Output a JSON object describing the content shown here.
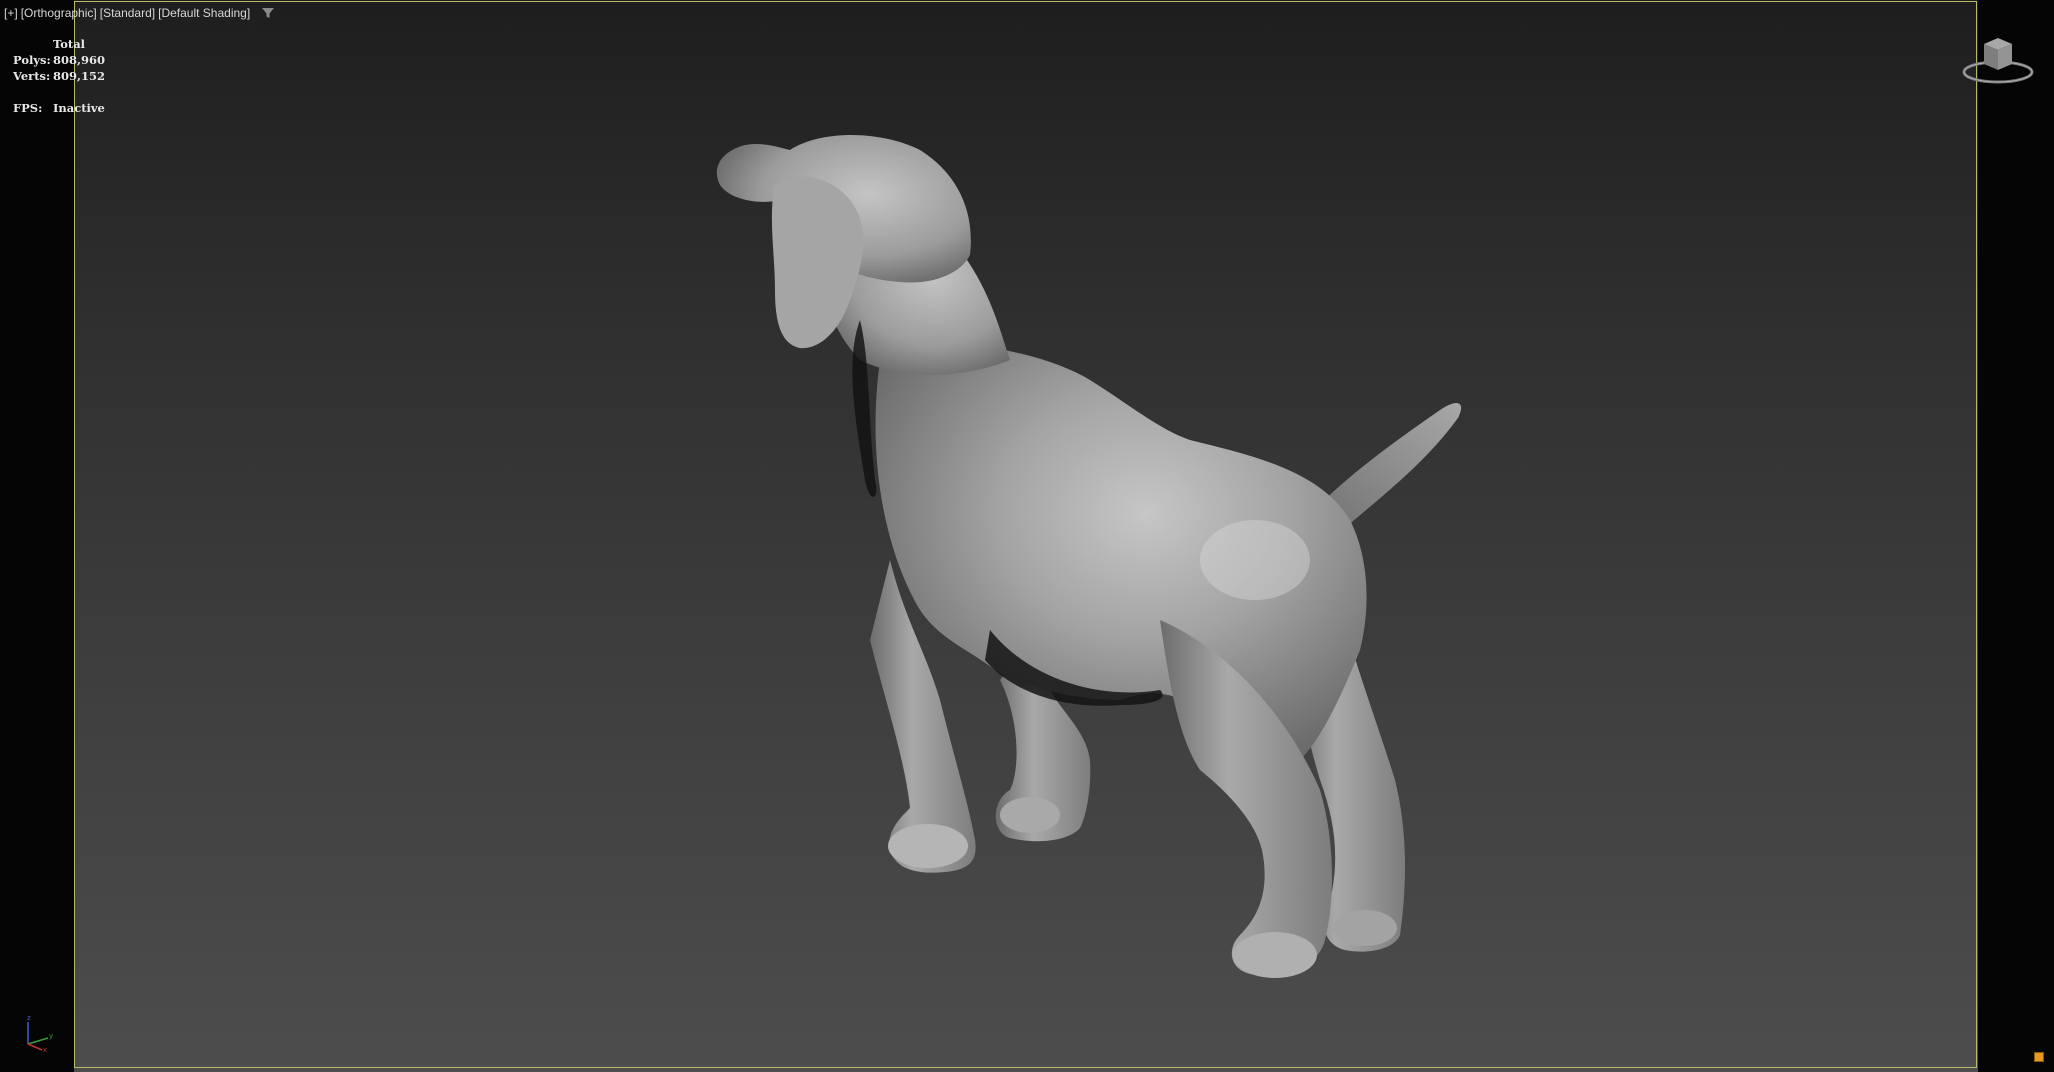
{
  "viewport": {
    "menu_plus": "[+]",
    "menu_view": "[Orthographic]",
    "menu_standard": "[Standard]",
    "menu_shading": "[Default Shading]",
    "filter_icon": "filter-icon"
  },
  "stats": {
    "header": "Total",
    "polys_label": "Polys:",
    "polys_value": "808,960",
    "verts_label": "Verts:",
    "verts_value": "809,152",
    "fps_label": "FPS:",
    "fps_value": "Inactive"
  },
  "scene": {
    "object_icon": "dog-model",
    "viewcube_icon": "viewcube-icon",
    "axis_icon": "axis-tripod-icon",
    "axis_labels": {
      "z": "z",
      "y": "y",
      "x": "x"
    }
  },
  "colors": {
    "safe_frame": "#b9b96a",
    "viewport_top": "#1e1e1e",
    "viewport_bottom": "#4d4d4d",
    "model_gray": "#9a9a9a",
    "badge": "#e39a1e"
  }
}
